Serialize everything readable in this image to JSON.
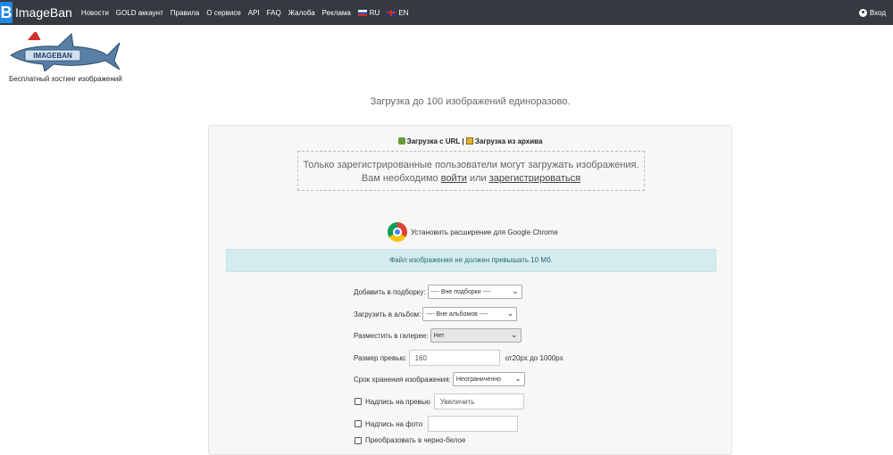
{
  "header": {
    "brand_letter": "B",
    "brand": "ImageBan",
    "nav": [
      "Новости",
      "GOLD аккаунт",
      "Правила",
      "О сервисе",
      "API",
      "FAQ",
      "Жалоба",
      "Реклама"
    ],
    "lang_ru": "RU",
    "lang_en": "EN",
    "login": "Вход"
  },
  "logo": {
    "text": "IMAGEBAN",
    "tagline": "Бесплатный хостинг изображений"
  },
  "headline": "Загрузка до 100 изображений единоразово.",
  "upload": {
    "url_link": "Загрузка с URL",
    "separator": "|",
    "archive_link": "Загрузка из архива",
    "dropzone_line1": "Только зарегистрированные пользователи могут загружать изображения.",
    "dropzone_line2_pre": "Вам необходимо ",
    "dropzone_login": "войти",
    "dropzone_or": " или ",
    "dropzone_register": "зарегистрироваться",
    "chrome_ext": "Установить расширение для Google Chrome",
    "notice": "Файл изображения не должен превышать 10 Мб."
  },
  "form": {
    "collection_label": "Добавить в подборку:",
    "collection_value": "---- Вне подборки ----",
    "album_label": "Загрузить в альбом:",
    "album_value": "---- Вне альбомов ----",
    "gallery_label": "Разместить в галерее:",
    "gallery_value": "Нет",
    "preview_label": "Размер превью:",
    "preview_value": "160",
    "preview_hint": "от20px до 1000px",
    "storage_label": "Срок хранения изображения:",
    "storage_value": "Неограниченно",
    "caption_preview_label": "Надпись на превью",
    "caption_preview_value": "Увеличить",
    "caption_photo_label": "Надпись на фото",
    "caption_photo_value": "",
    "bw_label": "Преобразовать в черно-белое"
  }
}
